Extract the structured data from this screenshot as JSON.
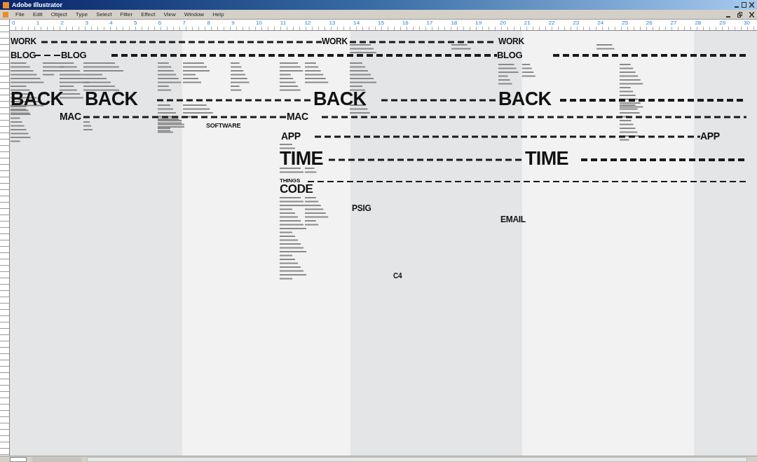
{
  "window": {
    "title": "Adobe Illustrator"
  },
  "menu": [
    "File",
    "Edit",
    "Object",
    "Type",
    "Select",
    "Filter",
    "Effect",
    "View",
    "Window",
    "Help"
  ],
  "ruler": {
    "marks": [
      "0",
      "1",
      "2",
      "3",
      "4",
      "5",
      "6",
      "7",
      "8",
      "9",
      "10",
      "11",
      "12",
      "13",
      "14",
      "15",
      "16",
      "17",
      "18",
      "19",
      "20",
      "21",
      "22",
      "23",
      "24",
      "25",
      "26",
      "27",
      "28",
      "29",
      "30"
    ]
  },
  "artwork": {
    "words": [
      {
        "text": "WORK"
      },
      {
        "text": "WORK"
      },
      {
        "text": "WORK"
      },
      {
        "text": "BLOG"
      },
      {
        "text": "BLOG"
      },
      {
        "text": "BLOG"
      },
      {
        "text": "BACK"
      },
      {
        "text": "BACK"
      },
      {
        "text": "BACK"
      },
      {
        "text": "BACK"
      },
      {
        "text": "MAC"
      },
      {
        "text": "MAC"
      },
      {
        "text": "SOFTWARE"
      },
      {
        "text": "APP"
      },
      {
        "text": "APP"
      },
      {
        "text": "TIME"
      },
      {
        "text": "TIME"
      },
      {
        "text": "THINGS"
      },
      {
        "text": "CODE"
      },
      {
        "text": "PSIG"
      },
      {
        "text": "EMAIL"
      },
      {
        "text": "C4"
      }
    ]
  }
}
